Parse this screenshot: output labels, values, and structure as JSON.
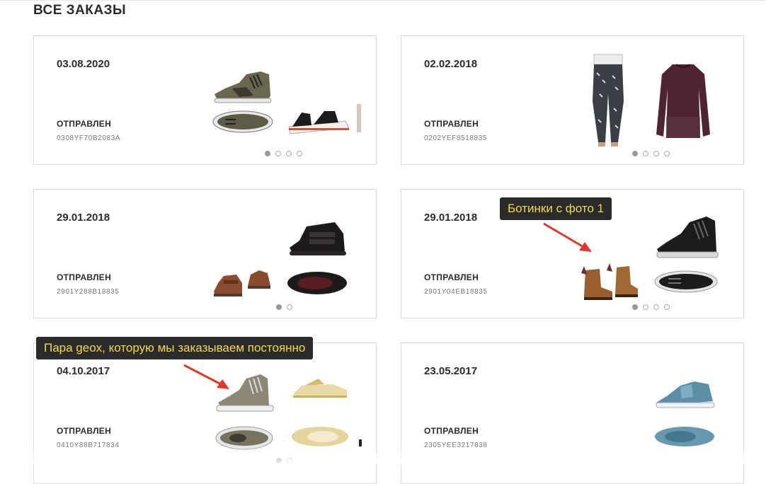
{
  "page": {
    "title": "ВСЕ ЗАКАЗЫ"
  },
  "orders": [
    {
      "date": "03.08.2020",
      "status": "ОТПРАВЛЕН",
      "code": "0308YF70B2083A",
      "pages": 4,
      "active_page": 1,
      "items": [
        "camo-high-top-sneaker",
        "camo-sneaker-top-view",
        "black-sandal",
        "partial-item"
      ]
    },
    {
      "date": "02.02.2018",
      "status": "ОТПРАВЛЕН",
      "code": "0202YEF8518835",
      "pages": 4,
      "active_page": 1,
      "items": [
        "printed-trousers",
        "burgundy-top"
      ]
    },
    {
      "date": "29.01.2018",
      "status": "ОТПРАВЛЕН",
      "code": "2901Y288B18835",
      "pages": 2,
      "active_page": 1,
      "items": [
        "black-velcro-shoe",
        "black-velcro-shoe-top",
        "brown-kids-shoe",
        "brown-kids-shoe-side"
      ]
    },
    {
      "date": "29.01.2018",
      "status": "ОТПРАВЛЕН",
      "code": "2901Y04EB18835",
      "pages": 4,
      "active_page": 1,
      "items": [
        "black-high-top-sneaker",
        "black-sneaker-top-view",
        "brown-fringe-boots"
      ]
    },
    {
      "date": "04.10.2017",
      "status": "ОТПРАВЛЕН",
      "code": "0410Y88B717834",
      "pages": 2,
      "active_page": 1,
      "items": [
        "khaki-geox-sneaker",
        "khaki-geox-sneaker-top",
        "gold-ballet-flat",
        "gold-ballet-flat-top"
      ]
    },
    {
      "date": "23.05.2017",
      "status": "ОТПРАВЛЕН",
      "code": "2305YEE3217838",
      "pages": 0,
      "active_page": 0,
      "items": [
        "blue-sneaker",
        "blue-sneaker-top-view"
      ]
    }
  ],
  "annotations": [
    {
      "text": "Ботинки с фото 1"
    },
    {
      "text": "Пара geox, которую мы заказываем постоянно"
    }
  ],
  "colors": {
    "accent_annotation_text": "#f5d84a",
    "annotation_bg": "#2b2b2b",
    "arrow": "#e0362b",
    "border": "#d9d9d9"
  }
}
